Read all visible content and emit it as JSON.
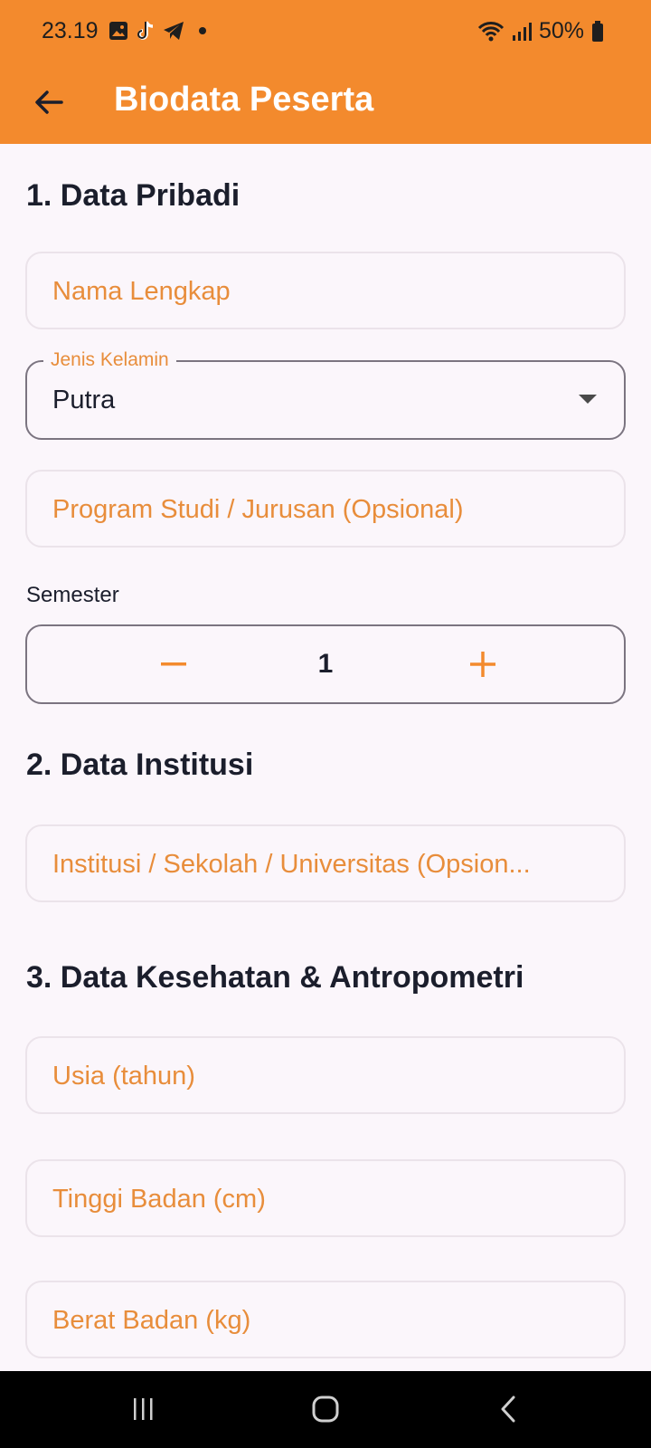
{
  "status_bar": {
    "time": "23.19",
    "battery": "50%",
    "icons": [
      "gallery-icon",
      "tiktok-icon",
      "telegram-icon",
      "dot-icon",
      "wifi-icon",
      "signal-icon",
      "battery-icon"
    ]
  },
  "app_bar": {
    "title": "Biodata Peserta",
    "back_icon": "arrow-back-icon"
  },
  "sections": {
    "pribadi": {
      "title": "1. Data Pribadi",
      "nama_placeholder": "Nama Lengkap",
      "gender_label": "Jenis Kelamin",
      "gender_value": "Putra",
      "prodi_placeholder": "Program Studi / Jurusan (Opsional)",
      "semester_label": "Semester",
      "semester_value": "1"
    },
    "institusi": {
      "title": "2. Data Institusi",
      "institusi_placeholder": "Institusi / Sekolah / Universitas (Opsion..."
    },
    "kesehatan": {
      "title": "3. Data Kesehatan & Antropometri",
      "usia_placeholder": "Usia (tahun)",
      "tinggi_placeholder": "Tinggi Badan (cm)",
      "berat_placeholder": "Berat Badan (kg)"
    }
  },
  "colors": {
    "primary": "#f38a2d",
    "placeholder": "#e88d3b",
    "background": "#fbf6fb",
    "text": "#1b1e2c"
  },
  "nav_bar": {
    "icons": [
      "recent-apps-icon",
      "home-icon",
      "back-nav-icon"
    ]
  }
}
